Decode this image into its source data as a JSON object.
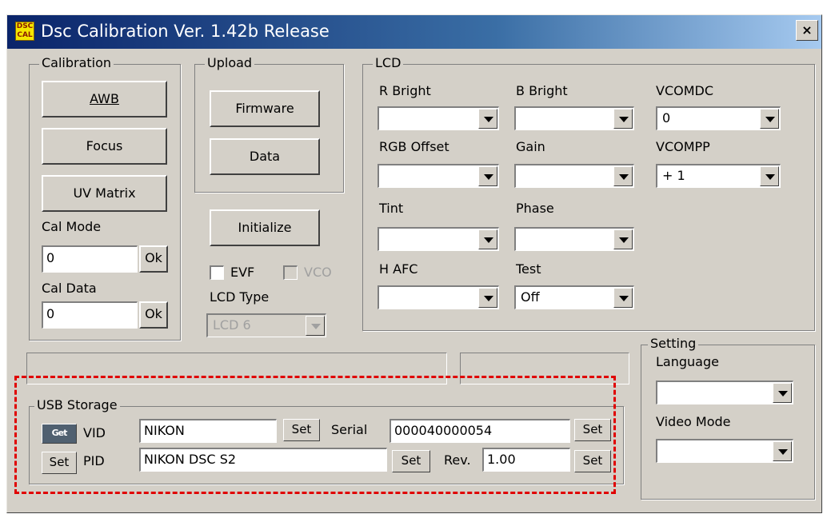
{
  "window": {
    "title": "Dsc Calibration  Ver. 1.42b Release",
    "icon_text": "DSC CAL",
    "close_label": "×"
  },
  "calibration": {
    "legend": "Calibration",
    "awb": "AWB",
    "focus": "Focus",
    "uv_matrix": "UV Matrix",
    "cal_mode_label": "Cal Mode",
    "cal_mode_value": "0",
    "cal_data_label": "Cal Data",
    "cal_data_value": "0",
    "ok": "Ok"
  },
  "upload": {
    "legend": "Upload",
    "firmware": "Firmware",
    "data": "Data"
  },
  "controls": {
    "initialize": "Initialize",
    "evf": "EVF",
    "vco": "VCO",
    "lcd_type_label": "LCD Type",
    "lcd_type_value": "LCD 6"
  },
  "lcd": {
    "legend": "LCD",
    "r_bright": "R Bright",
    "b_bright": "B Bright",
    "vcomdc": "VCOMDC",
    "vcomdc_value": "0",
    "rgb_offset": "RGB Offset",
    "gain": "Gain",
    "vcompp": "VCOMPP",
    "vcompp_value": "+ 1",
    "tint": "Tint",
    "phase": "Phase",
    "h_afc": "H AFC",
    "test": "Test",
    "test_value": "Off"
  },
  "usb": {
    "legend": "USB Storage",
    "get": "Get",
    "vid_label": "VID",
    "vid_value": "NIKON",
    "pid_label": "PID",
    "pid_value": "NIKON DSC S2",
    "serial_label": "Serial",
    "serial_value": "000040000054",
    "rev_label": "Rev.",
    "rev_value": "1.00",
    "set": "Set"
  },
  "setting": {
    "legend": "Setting",
    "language_label": "Language",
    "video_mode_label": "Video Mode"
  },
  "colors": {
    "titlebar_start": "#0a246a",
    "face": "#d4d0c8",
    "highlight_dash": "#e00000"
  }
}
